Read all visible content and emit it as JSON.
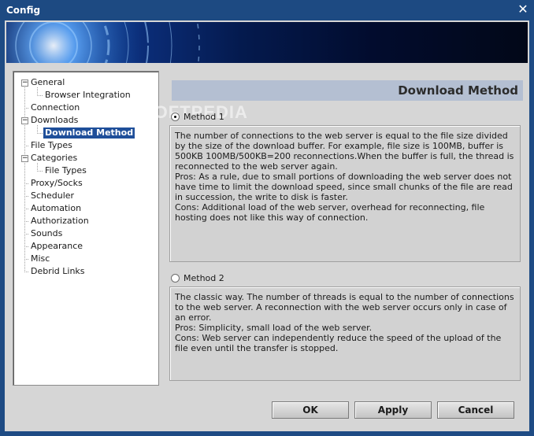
{
  "window": {
    "title": "Config"
  },
  "tree": {
    "items": [
      {
        "label": "General",
        "expanded": true,
        "level": 0
      },
      {
        "label": "Browser Integration",
        "level": 1
      },
      {
        "label": "Connection",
        "level": 0
      },
      {
        "label": "Downloads",
        "expanded": true,
        "level": 0
      },
      {
        "label": "Download Method",
        "level": 1,
        "selected": true
      },
      {
        "label": "File Types",
        "level": 0
      },
      {
        "label": "Categories",
        "expanded": true,
        "level": 0
      },
      {
        "label": "File Types",
        "level": 1
      },
      {
        "label": "Proxy/Socks",
        "level": 0
      },
      {
        "label": "Scheduler",
        "level": 0
      },
      {
        "label": "Automation",
        "level": 0
      },
      {
        "label": "Authorization",
        "level": 0
      },
      {
        "label": "Sounds",
        "level": 0
      },
      {
        "label": "Appearance",
        "level": 0
      },
      {
        "label": "Misc",
        "level": 0
      },
      {
        "label": "Debrid Links",
        "level": 0
      }
    ]
  },
  "panel": {
    "title": "Download Method",
    "watermark": "SOFTPEDIA",
    "method1": {
      "label": "Method 1",
      "selected": true,
      "lines": [
        "The number of connections to the web server is equal to the file size divided by the size of the download buffer. For example, file size is 100MB, buffer is 500KB 100MB/500KB=200 reconnections.When the buffer is full, the thread is reconnected to the web server again.",
        "Pros: As a rule, due to small portions of downloading the web server does not have time to limit the download speed, since small chunks of the file are read in succession, the write to disk is faster.",
        "Cons: Additional load of the web server, overhead for reconnecting, file hosting does not like this way of connection."
      ]
    },
    "method2": {
      "label": "Method 2",
      "selected": false,
      "lines": [
        "The classic way. The number of threads is equal to the number of connections to the web server. A reconnection with the web server occurs only in case of an error.",
        "Pros: Simplicity, small load of the web server.",
        "Cons: Web server can independently reduce the speed of the upload of the file even until the transfer is stopped."
      ]
    }
  },
  "buttons": {
    "ok": "OK",
    "apply": "Apply",
    "cancel": "Cancel"
  },
  "icons": {
    "close": "close-icon",
    "expand": "minus-icon"
  },
  "colors": {
    "title_bar": "#1d4a82",
    "selection": "#1f4f9a",
    "header_bar": "#b4bfd2"
  }
}
